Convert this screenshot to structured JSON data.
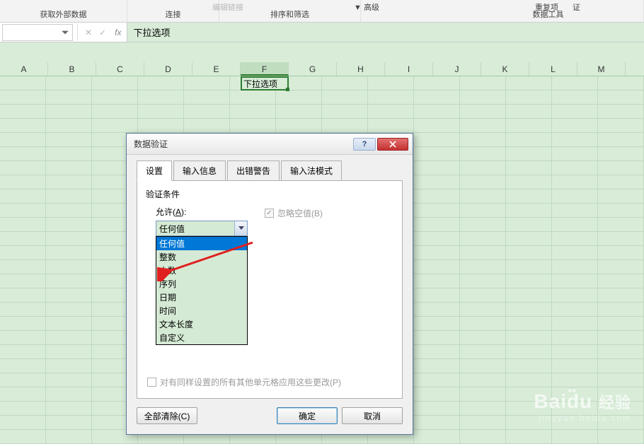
{
  "ribbon": {
    "get_external_data": "获取外部数据",
    "edit_links": "编辑链接",
    "connections": "连接",
    "advanced": "高级",
    "sort_filter": "排序和筛选",
    "duplicates": "重复项",
    "validation": "证",
    "data_tools": "数据工具"
  },
  "formula_bar": {
    "content": "下拉选项"
  },
  "columns": [
    "A",
    "B",
    "C",
    "D",
    "E",
    "F",
    "G",
    "H",
    "I",
    "J",
    "K",
    "L",
    "M"
  ],
  "active_cell": {
    "value": "下拉选项"
  },
  "dialog": {
    "title": "数据验证",
    "tabs": {
      "settings": "设置",
      "input_msg": "输入信息",
      "error_alert": "出错警告",
      "ime_mode": "输入法模式"
    },
    "fieldset_label": "验证条件",
    "allow_label_prefix": "允许(",
    "allow_label_key": "A",
    "allow_label_suffix": "):",
    "allow_value": "任何值",
    "dropdown_options": [
      "任何值",
      "整数",
      "小数",
      "序列",
      "日期",
      "时间",
      "文本长度",
      "自定义"
    ],
    "ignore_blank": "忽略空值(B)",
    "apply_same": "对有同样设置的所有其他单元格应用这些更改(P)",
    "buttons": {
      "clear_all": "全部清除(C)",
      "ok": "确定",
      "cancel": "取消"
    }
  },
  "watermark": {
    "brand_en": "Bai",
    "brand_middle": "d",
    "brand_cn": "经验",
    "url": "jingyan.baidu.com"
  }
}
